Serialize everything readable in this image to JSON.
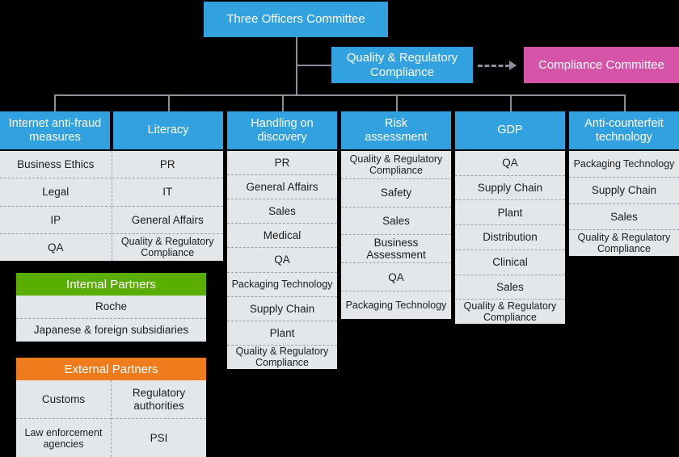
{
  "colors": {
    "background": "#000000",
    "node_blue": "#32a1e0",
    "node_pink": "#d554a8",
    "panel_bg": "#e3e7ea",
    "internal_partners": "#5aae00",
    "external_partners": "#ef7c1c",
    "connector": "#8a9099"
  },
  "top": {
    "committee": "Three Officers Committee",
    "quality": "Quality & Regulatory\nCompliance",
    "quality_line1": "Quality & Regulatory",
    "quality_line2": "Compliance",
    "compliance_committee": "Compliance Committee"
  },
  "columns": [
    {
      "header": "Internet anti-fraud measures",
      "header_line1": "Internet anti-fraud",
      "header_line2": "measures",
      "items": [
        "Business Ethics",
        "Legal",
        "IP",
        "QA"
      ]
    },
    {
      "header": "Literacy",
      "items": [
        "PR",
        "IT",
        "General Affairs",
        "Quality & Regulatory Compliance"
      ]
    },
    {
      "header": "Handling on discovery",
      "header_line1": "Handling on",
      "header_line2": "discovery",
      "items": [
        "PR",
        "General Affairs",
        "Sales",
        "Medical",
        "QA",
        "Packaging Technology",
        "Supply Chain",
        "Plant",
        "Quality & Regulatory Compliance"
      ]
    },
    {
      "header": "Risk assessment",
      "header_line1": "Risk",
      "header_line2": "assessment",
      "items": [
        "Quality & Regulatory Compliance",
        "Safety",
        "Sales",
        "Business Assessment",
        "QA",
        "Packaging Technology"
      ]
    },
    {
      "header": "GDP",
      "items": [
        "QA",
        "Supply Chain",
        "Plant",
        "Distribution",
        "Clinical",
        "Sales",
        "Quality & Regulatory Compliance"
      ]
    },
    {
      "header": "Anti-counterfeit technology",
      "header_line1": "Anti-counterfeit",
      "header_line2": "technology",
      "items": [
        "Packaging Technology",
        "Supply Chain",
        "Sales",
        "Quality & Regulatory Compliance"
      ]
    }
  ],
  "groups": [
    {
      "title": "Internal Partners",
      "rows": [
        "Roche",
        "Japanese & foreign subsidiaries"
      ]
    },
    {
      "title": "External Partners",
      "left": [
        "Customs",
        "Law enforcement agencies"
      ],
      "right": [
        "Regulatory authorities",
        "PSI"
      ]
    }
  ]
}
